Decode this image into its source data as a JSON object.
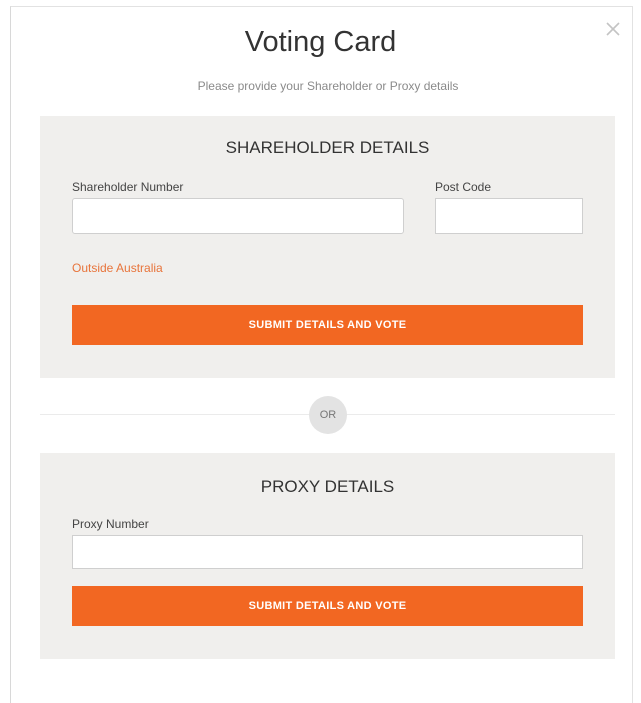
{
  "dialog": {
    "title": "Voting Card",
    "subtitle": "Please provide your Shareholder or Proxy details",
    "close_icon": "close-icon"
  },
  "shareholder": {
    "heading": "SHAREHOLDER DETAILS",
    "number_label": "Shareholder Number",
    "number_value": "",
    "postcode_label": "Post Code",
    "postcode_value": "",
    "outside_link": "Outside Australia",
    "submit_label": "SUBMIT DETAILS AND VOTE"
  },
  "separator": {
    "label": "OR"
  },
  "proxy": {
    "heading": "PROXY DETAILS",
    "number_label": "Proxy Number",
    "number_value": "",
    "submit_label": "SUBMIT DETAILS AND VOTE"
  },
  "colors": {
    "accent": "#f26722",
    "link": "#e8743b",
    "panel_bg": "#f0efed"
  }
}
